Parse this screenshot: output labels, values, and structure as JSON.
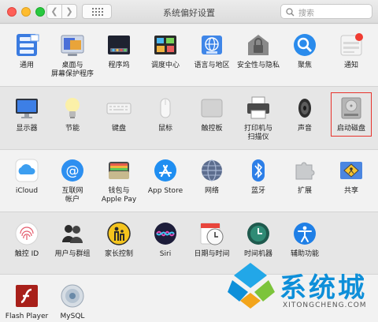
{
  "window": {
    "title": "系统偏好设置",
    "search_placeholder": "搜索"
  },
  "rows": [
    [
      {
        "label": "通用",
        "icon": "general-icon"
      },
      {
        "label": "桌面与\n屏幕保护程序",
        "icon": "desktop-screensaver-icon"
      },
      {
        "label": "程序坞",
        "icon": "dock-icon"
      },
      {
        "label": "调度中心",
        "icon": "mission-control-icon"
      },
      {
        "label": "语言与地区",
        "icon": "language-region-icon"
      },
      {
        "label": "安全性与隐私",
        "icon": "security-privacy-icon"
      },
      {
        "label": "聚焦",
        "icon": "spotlight-icon"
      },
      {
        "label": "通知",
        "icon": "notifications-icon"
      }
    ],
    [
      {
        "label": "显示器",
        "icon": "displays-icon"
      },
      {
        "label": "节能",
        "icon": "energy-saver-icon"
      },
      {
        "label": "键盘",
        "icon": "keyboard-icon"
      },
      {
        "label": "鼠标",
        "icon": "mouse-icon"
      },
      {
        "label": "触控板",
        "icon": "trackpad-icon"
      },
      {
        "label": "打印机与\n扫描仪",
        "icon": "printers-scanners-icon"
      },
      {
        "label": "声音",
        "icon": "sound-icon"
      },
      {
        "label": "启动磁盘",
        "icon": "startup-disk-icon"
      }
    ],
    [
      {
        "label": "iCloud",
        "icon": "icloud-icon"
      },
      {
        "label": "互联网\n帐户",
        "icon": "internet-accounts-icon"
      },
      {
        "label": "钱包与\nApple Pay",
        "icon": "wallet-applepay-icon"
      },
      {
        "label": "App Store",
        "icon": "app-store-icon"
      },
      {
        "label": "网络",
        "icon": "network-icon"
      },
      {
        "label": "蓝牙",
        "icon": "bluetooth-icon"
      },
      {
        "label": "扩展",
        "icon": "extensions-icon"
      },
      {
        "label": "共享",
        "icon": "sharing-icon"
      }
    ],
    [
      {
        "label": "触控 ID",
        "icon": "touch-id-icon"
      },
      {
        "label": "用户与群组",
        "icon": "users-groups-icon"
      },
      {
        "label": "家长控制",
        "icon": "parental-controls-icon"
      },
      {
        "label": "Siri",
        "icon": "siri-icon"
      },
      {
        "label": "日期与时间",
        "icon": "date-time-icon"
      },
      {
        "label": "时间机器",
        "icon": "time-machine-icon"
      },
      {
        "label": "辅助功能",
        "icon": "accessibility-icon"
      }
    ],
    [
      {
        "label": "Flash Player",
        "icon": "flash-player-icon"
      },
      {
        "label": "MySQL",
        "icon": "mysql-icon"
      }
    ]
  ],
  "selected": "启动磁盘",
  "watermark": {
    "title": "系统城",
    "subtitle": "XITONGCHENG.COM"
  }
}
